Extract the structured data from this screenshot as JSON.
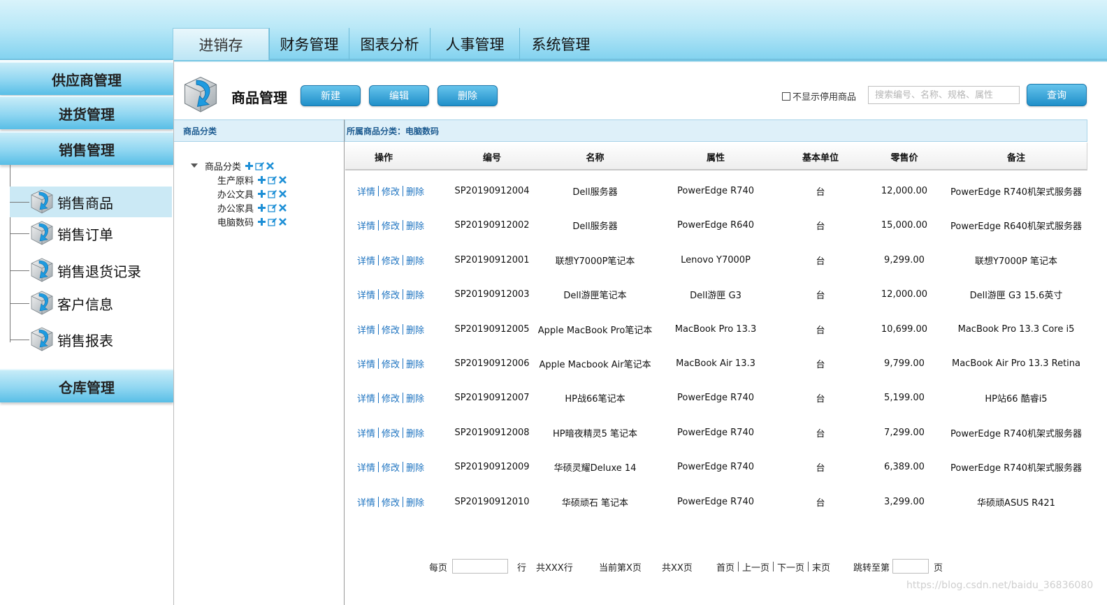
{
  "top_nav": {
    "tabs": [
      {
        "label": "进销存",
        "active": true
      },
      {
        "label": "财务管理",
        "active": false
      },
      {
        "label": "图表分析",
        "active": false
      },
      {
        "label": "人事管理",
        "active": false
      },
      {
        "label": "系统管理",
        "active": false
      }
    ]
  },
  "sidebar": {
    "sections": [
      {
        "label": "供应商管理"
      },
      {
        "label": "进货管理"
      },
      {
        "label": "销售管理"
      },
      {
        "label": "仓库管理"
      }
    ],
    "items": [
      {
        "label": "销售商品",
        "active": true,
        "icon": "cube-arrow-icon"
      },
      {
        "label": "销售订单",
        "active": false,
        "icon": "cube-arrow-icon"
      },
      {
        "label": "销售退货记录",
        "active": false,
        "icon": "cube-arrow-icon"
      },
      {
        "label": "客户信息",
        "active": false,
        "icon": "cube-arrow-icon"
      },
      {
        "label": "销售报表",
        "active": false,
        "icon": "cube-arrow-icon"
      }
    ]
  },
  "toolbar": {
    "title": "商品管理",
    "new_label": "新建",
    "edit_label": "编辑",
    "delete_label": "删除",
    "hide_disabled_label": "不显示停用商品",
    "hide_disabled_checked": false,
    "search_placeholder": "搜索编号、名称、规格、属性",
    "search_value": "",
    "query_label": "查询"
  },
  "category_panel": {
    "header": "商品分类",
    "tree": {
      "root": "商品分类",
      "children": [
        "生产原料",
        "办公文具",
        "办公家具",
        "电脑数码"
      ]
    }
  },
  "product_list": {
    "header": "所属商品分类：电脑数码",
    "columns": [
      "操作",
      "编号",
      "名称",
      "属性",
      "基本单位",
      "零售价",
      "备注"
    ],
    "actions": [
      "详情",
      "修改",
      "删除"
    ],
    "rows": [
      {
        "code": "SP20190912004",
        "name": "Dell服务器",
        "attr": "PowerEdge R740",
        "unit": "台",
        "price": "12,000.00",
        "note": "PowerEdge R740机架式服务器"
      },
      {
        "code": "SP20190912002",
        "name": "Dell服务器",
        "attr": "PowerEdge R640",
        "unit": "台",
        "price": "15,000.00",
        "note": "PowerEdge R640机架式服务器"
      },
      {
        "code": "SP20190912001",
        "name": "联想Y7000P笔记本",
        "attr": "Lenovo Y7000P",
        "unit": "台",
        "price": "9,299.00",
        "note": "联想Y7000P 笔记本"
      },
      {
        "code": "SP20190912003",
        "name": "Dell游匣笔记本",
        "attr": "Dell游匣 G3",
        "unit": "台",
        "price": "12,000.00",
        "note": "Dell游匣 G3 15.6英寸"
      },
      {
        "code": "SP20190912005",
        "name": "Apple MacBook Pro笔记本",
        "attr": "MacBook Pro 13.3",
        "unit": "台",
        "price": "10,699.00",
        "note": "MacBook Pro 13.3 Core i5"
      },
      {
        "code": "SP20190912006",
        "name": "Apple Macbook Air笔记本",
        "attr": "MacBook Air 13.3",
        "unit": "台",
        "price": "9,799.00",
        "note": "MacBook Air Pro 13.3 Retina"
      },
      {
        "code": "SP20190912007",
        "name": "HP战66笔记本",
        "attr": "PowerEdge R740",
        "unit": "台",
        "price": "5,199.00",
        "note": "HP站66 酷睿i5"
      },
      {
        "code": "SP20190912008",
        "name": "HP暗夜精灵5 笔记本",
        "attr": "PowerEdge R740",
        "unit": "台",
        "price": "7,299.00",
        "note": "PowerEdge R740机架式服务器"
      },
      {
        "code": "SP20190912009",
        "name": "华硕灵耀Deluxe 14",
        "attr": "PowerEdge R740",
        "unit": "台",
        "price": "6,389.00",
        "note": "PowerEdge R740机架式服务器"
      },
      {
        "code": "SP20190912010",
        "name": "华硕顽石 笔记本",
        "attr": "PowerEdge R740",
        "unit": "台",
        "price": "3,299.00",
        "note": "华硕顽ASUS R421"
      }
    ]
  },
  "pagination": {
    "per_page_label": "每页",
    "per_page_value": "",
    "rows_unit": "行",
    "total_rows": "共XXX行",
    "current_page": "当前第X页",
    "total_pages": "共XX页",
    "first": "首页",
    "prev": "上一页",
    "next": "下一页",
    "last": "末页",
    "jump_label": "跳转至第",
    "jump_value": "",
    "page_unit": "页"
  },
  "watermark": "https://blog.csdn.net/baidu_36836080",
  "colors": {
    "accent": "#1f8fc9",
    "link": "#1d73c0",
    "header_blue": "#58bee6",
    "panel_header_bg": "#def0f9",
    "panel_header_text": "#1e5c91"
  }
}
